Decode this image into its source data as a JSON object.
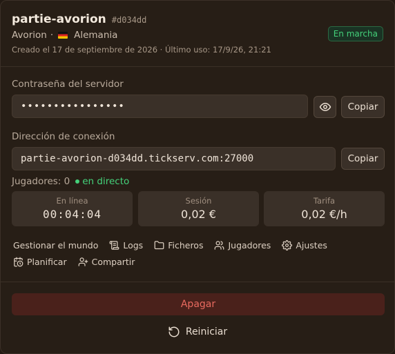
{
  "server": {
    "name": "partie-avorion",
    "id": "#d034dd",
    "game": "Avorion",
    "separator": "·",
    "country": "Alemania",
    "meta": "Creado el 17 de septiembre de 2026 · Último uso: 17/9/26, 21:21",
    "status": "En marcha"
  },
  "password": {
    "label": "Contraseña del servidor",
    "value": "••••••••••••••••",
    "copy_label": "Copiar"
  },
  "address": {
    "label": "Dirección de conexión",
    "value": "partie-avorion-d034dd.tickserv.com:27000",
    "copy_label": "Copiar"
  },
  "players": {
    "label": "Jugadores: 0",
    "live": "en directo"
  },
  "stats": [
    {
      "label": "En línea",
      "value": "00:04:04"
    },
    {
      "label": "Sesión",
      "value": "0,02 €"
    },
    {
      "label": "Tarifa",
      "value": "0,02 €/h"
    }
  ],
  "actions": {
    "manage": "Gestionar el mundo",
    "logs": "Logs",
    "files": "Ficheros",
    "players": "Jugadores",
    "settings": "Ajustes",
    "schedule": "Planificar",
    "share": "Compartir"
  },
  "buttons": {
    "stop": "Apagar",
    "restart": "Reiniciar"
  },
  "colors": {
    "status_green": "#44d17a",
    "danger": "#e86a5f",
    "background": "#271e16"
  },
  "icons": [
    "eye-icon",
    "logs-icon",
    "folder-icon",
    "users-icon",
    "gear-icon",
    "calendar-icon",
    "user-plus-icon",
    "restart-icon",
    "flag-germany-icon"
  ]
}
